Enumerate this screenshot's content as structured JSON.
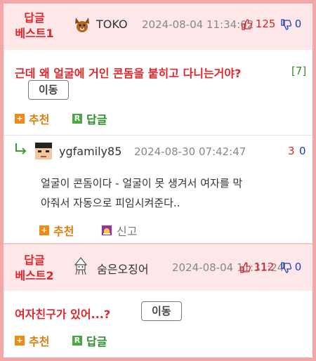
{
  "posts": [
    {
      "best_label_line1": "답글",
      "best_label_line2": "베스트1",
      "avatar_icon": "dog-icon",
      "nick": "TOKO",
      "date": "2024-08-04 11:34:02",
      "upvotes": "125",
      "downvotes": "0",
      "title": "근데 왜 얼굴에 거인 콘돔을 붙히고 다니는거야?",
      "reply_count": "[7]",
      "move_label": "이동",
      "recommend_label": "추천",
      "reply_label": "답글"
    },
    {
      "best_label_line1": "답글",
      "best_label_line2": "베스트2",
      "avatar_icon": "squid-icon",
      "nick": "숨은오징어",
      "date": "2024-08-04 11:31:24",
      "upvotes": "112",
      "downvotes": "0",
      "title": "여자친구가 있어...?",
      "move_label": "이동",
      "recommend_label": "추천",
      "reply_label": "답글"
    }
  ],
  "reply": {
    "avatar_icon": "pixel-face-icon",
    "nick": "ygfamily85",
    "date": "2024-08-30 07:42:47",
    "upvotes": "3",
    "downvotes": "0",
    "body_line1": "얼굴이 콘돔이다 - 얼굴이 못 생겨서 여자를 막",
    "body_line2": "아줘서 자동으로 피임시켜준다..",
    "recommend_label": "추천",
    "report_label": "신고"
  },
  "colors": {
    "outer_border": "#f3a7a9",
    "best_header_bg": "#fde7e8",
    "best_label": "#e2262b",
    "upvote": "#d9242a",
    "downvote": "#1b3fbf",
    "recommend": "#e07b0c",
    "reply_action": "#2f8d2f"
  }
}
